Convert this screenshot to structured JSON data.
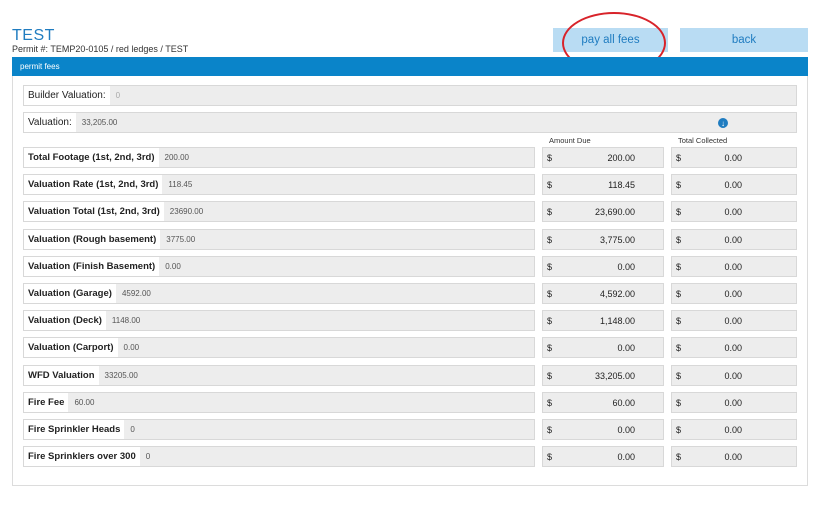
{
  "header": {
    "title": "TEST",
    "subtitle": "Permit #: TEMP20-0105 / red ledges / TEST",
    "pay_all_fees_label": "pay all fees",
    "back_label": "back"
  },
  "section": {
    "label": "permit fees"
  },
  "builder_valuation": {
    "label": "Builder Valuation:",
    "value": "0"
  },
  "valuation": {
    "label": "Valuation:",
    "value": "33,205.00"
  },
  "columns": {
    "amount_due": "Amount Due",
    "total_collected": "Total Collected"
  },
  "currency_symbol": "$",
  "fees": [
    {
      "label": "Total Footage (1st, 2nd, 3rd)",
      "value": "200.00",
      "amount_due": "200.00",
      "collected": "0.00"
    },
    {
      "label": "Valuation Rate (1st, 2nd, 3rd)",
      "value": "118.45",
      "amount_due": "118.45",
      "collected": "0.00"
    },
    {
      "label": "Valuation Total (1st, 2nd, 3rd)",
      "value": "23690.00",
      "amount_due": "23,690.00",
      "collected": "0.00"
    },
    {
      "label": "Valuation (Rough basement)",
      "value": "3775.00",
      "amount_due": "3,775.00",
      "collected": "0.00"
    },
    {
      "label": "Valuation (Finish Basement)",
      "value": "0.00",
      "amount_due": "0.00",
      "collected": "0.00"
    },
    {
      "label": "Valuation (Garage)",
      "value": "4592.00",
      "amount_due": "4,592.00",
      "collected": "0.00"
    },
    {
      "label": "Valuation (Deck)",
      "value": "1148.00",
      "amount_due": "1,148.00",
      "collected": "0.00"
    },
    {
      "label": "Valuation (Carport)",
      "value": "0.00",
      "amount_due": "0.00",
      "collected": "0.00"
    },
    {
      "label": "WFD Valuation",
      "value": "33205.00",
      "amount_due": "33,205.00",
      "collected": "0.00"
    },
    {
      "label": "Fire Fee",
      "value": "60.00",
      "amount_due": "60.00",
      "collected": "0.00"
    },
    {
      "label": "Fire Sprinkler Heads",
      "value": "0",
      "amount_due": "0.00",
      "collected": "0.00"
    },
    {
      "label": "Fire Sprinklers over 300",
      "value": "0",
      "amount_due": "0.00",
      "collected": "0.00"
    }
  ]
}
